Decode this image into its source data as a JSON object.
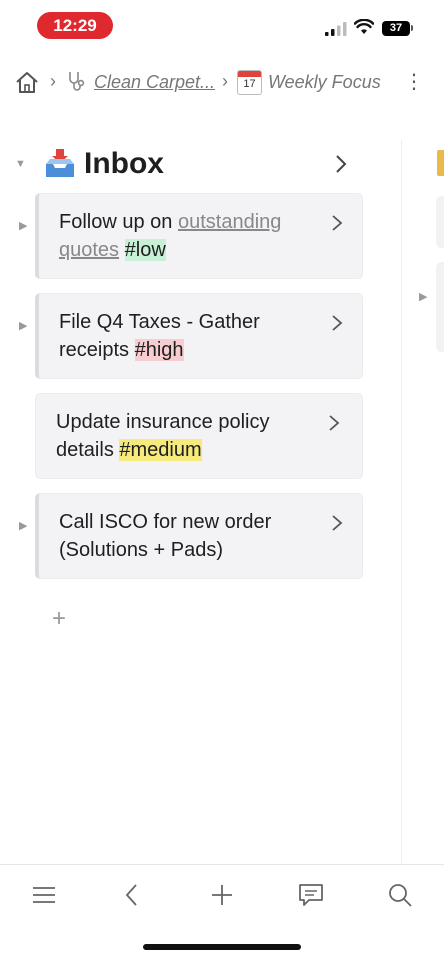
{
  "status_bar": {
    "time": "12:29",
    "battery": "37"
  },
  "breadcrumb": {
    "items": [
      {
        "label": "Clean Carpet...",
        "icon": "stethoscope-icon",
        "link": true
      },
      {
        "label": "Weekly Focus",
        "icon": "calendar-icon",
        "calendar_day": "17",
        "link": false
      }
    ]
  },
  "section": {
    "title": "Inbox",
    "icon": "inbox-tray-icon"
  },
  "cards": [
    {
      "text": "Follow up on ",
      "link_text": "outstanding quotes",
      "tag": "#low",
      "tag_color": "#c8f0d6",
      "has_children": true
    },
    {
      "text": "File Q4 Taxes - Gather receipts ",
      "tag": "#high",
      "tag_color": "#f8cdd1",
      "has_children": true
    },
    {
      "text": "Update insurance policy details ",
      "tag": "#medium",
      "tag_color": "#f6ea7c",
      "has_children": false
    },
    {
      "text": "Call ISCO for new order (Solutions + Pads)",
      "has_children": true
    }
  ],
  "add_item": "+",
  "toolbar": {
    "buttons": [
      "menu-icon",
      "back-icon",
      "add-icon",
      "comment-icon",
      "search-icon"
    ]
  },
  "colors": {
    "status_pill": "#e0292f",
    "card_bg": "#f3f3f5",
    "text": "#1f1f1f",
    "muted": "#777777"
  }
}
